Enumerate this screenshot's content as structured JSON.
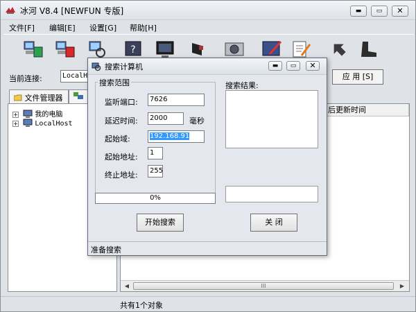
{
  "app": {
    "title": "冰河 V8.4 [NEWFUN 专版]",
    "window_buttons": {
      "minimize": "▬",
      "maximize": "▭",
      "close": "✕"
    }
  },
  "menu": [
    "文件[F]",
    "编辑[E]",
    "设置[G]",
    "帮助[H]"
  ],
  "toolbar": {
    "icons": [
      "add-host-icon",
      "delete-host-icon",
      "search-computer-icon",
      "help-icon",
      "screen-capture-icon",
      "screen-control-icon",
      "drive-icon",
      "settings-icon",
      "config-icon",
      "tools-icon",
      "arrow-icon",
      "boot-icon"
    ]
  },
  "connection": {
    "label": "当前连接:",
    "value": "LocalHost",
    "apply_button": "应 用 [S]"
  },
  "tabs": {
    "file_manager": "文件管理器"
  },
  "tree": {
    "my_computer": "我的电脑",
    "local_host": "LocalHost",
    "expand": "+"
  },
  "list": {
    "columns": [
      "后更新时间"
    ]
  },
  "scrollbar": {
    "left": "◀",
    "right": "▶",
    "grip": "III"
  },
  "status": {
    "text": "共有1个对象"
  },
  "dialog": {
    "title": "搜索计算机",
    "window_buttons": {
      "minimize": "▬",
      "maximize": "▭",
      "close": "✕"
    },
    "group_title": "搜索范围",
    "fields": {
      "port_label": "监听端口:",
      "port_value": "7626",
      "delay_label": "延迟时间:",
      "delay_value": "2000",
      "delay_unit": "毫秒",
      "domain_label": "起始域:",
      "domain_value": "192.168.91",
      "start_label": "起始地址:",
      "start_value": "1",
      "end_label": "终止地址:",
      "end_value": "255"
    },
    "result_label": "搜索结果:",
    "progress": {
      "value": 0,
      "text": "0%"
    },
    "start_button": "开始搜索",
    "close_button": "关 闭",
    "status": "准备搜索"
  },
  "colors": {
    "accent_selection": "#3399ff",
    "window_bg": "#dfe3e8"
  }
}
